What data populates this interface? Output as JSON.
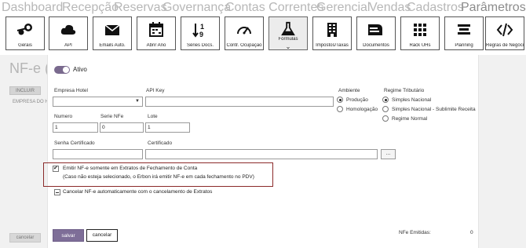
{
  "topnav": [
    "Dashboard",
    "Recepção",
    "Reservas",
    "Governança",
    "Contas Correntes",
    "Gerencial",
    "Vendas",
    "Cadastros",
    "Parâmetros"
  ],
  "toolbar": [
    {
      "label": "Gerais",
      "icon": "steam-icon"
    },
    {
      "label": "API",
      "icon": "cloud-icon"
    },
    {
      "label": "Emails Auto.",
      "icon": "envelope-icon"
    },
    {
      "label": "Abrir Ano",
      "icon": "calendar-icon"
    },
    {
      "label": "Séries Docs.",
      "icon": "sort-numeric-icon"
    },
    {
      "label": "Contr. Ocupação",
      "icon": "gauge-icon"
    },
    {
      "label": "Fórmulas",
      "icon": "flask-icon"
    },
    {
      "label": "Impostos/Taxas",
      "icon": "building-icon"
    },
    {
      "label": "Documentos",
      "icon": "documents-icon"
    },
    {
      "label": "Rack UHs",
      "icon": "grid-icon"
    },
    {
      "label": "Planning",
      "icon": "planning-icon"
    },
    {
      "label": "Regras de Negócio",
      "icon": "code-icon"
    }
  ],
  "toolbar_chevron": "⌄",
  "background": {
    "title": "NF-e (N",
    "incluir": "INCLUIR",
    "empresa": "EMPRESA DO H",
    "cancelar": "cancelar"
  },
  "form": {
    "ativo_label": "Ativo",
    "empresa_hotel_label": "Empresa Hotel",
    "api_key_label": "API Key",
    "ambiente_label": "Ambiente",
    "ambiente_options": [
      "Produção",
      "Homologação"
    ],
    "regime_label": "Regime Tributário",
    "regime_options": [
      "Simples Nacional",
      "Simples Nacional - Sublimite Receita",
      "Regime Normal"
    ],
    "numero_label": "Numero",
    "numero_value": "1",
    "serie_label": "Serie NFe",
    "serie_value": "0",
    "lote_label": "Lote",
    "lote_value": "1",
    "senha_label": "Senha Certificado",
    "certificado_label": "Certificado",
    "browse_label": "...",
    "emitir_label": "Emitir NF-e somente em Extratos de Fechamento de Conta",
    "emitir_note": "(Caso não esteja selecionado, o Erbon irá emitir NF-e em cada fechamento no PDV)",
    "cancelar_auto_label": "Cancelar NF-e automaticamente com o cancelamento de Extratos",
    "salvar": "salvar",
    "cancelar": "cancelar",
    "nfe_emitidas_label": "NFe Emitidas:",
    "nfe_emitidas_value": "0"
  },
  "colors": {
    "accent": "#7e6e98",
    "highlight_border": "#8b2a2a"
  }
}
